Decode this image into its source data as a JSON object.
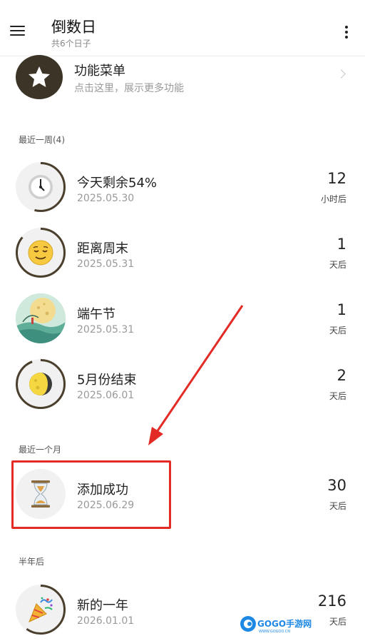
{
  "header": {
    "title": "倒数日",
    "subtitle": "共6个日子"
  },
  "feature": {
    "title": "功能菜单",
    "subtitle": "点击这里，展示更多功能"
  },
  "sections": {
    "week": "最近一周(4)",
    "month": "最近一个月",
    "half_year": "半年后"
  },
  "items": [
    {
      "title": "今天剩余54%",
      "date": "2025.05.30",
      "number": "12",
      "unit": "小时后",
      "icon": "clock-icon",
      "progress": 0.54
    },
    {
      "title": "距离周末",
      "date": "2025.05.31",
      "number": "1",
      "unit": "天后",
      "icon": "relieved-face-icon",
      "progress": 0.86
    },
    {
      "title": "端午节",
      "date": "2025.05.31",
      "number": "1",
      "unit": "天后",
      "icon": "festival-image",
      "progress": 1.0
    },
    {
      "title": "5月份结束",
      "date": "2025.06.01",
      "number": "2",
      "unit": "天后",
      "icon": "moon-icon",
      "progress": 0.94
    },
    {
      "title": "添加成功",
      "date": "2025.06.29",
      "number": "30",
      "unit": "天后",
      "icon": "hourglass-icon",
      "progress": 0.0
    },
    {
      "title": "新的一年",
      "date": "2026.01.01",
      "number": "216",
      "unit": "天后",
      "icon": "party-popper-icon",
      "progress": 0.6
    }
  ],
  "colors": {
    "accent": "#e32b26",
    "ring": "#4a3f2c",
    "feature_bg": "#3b3427"
  },
  "watermark": {
    "brand": "GOGO手游网",
    "site": "WWW.GOGOO.CN"
  }
}
